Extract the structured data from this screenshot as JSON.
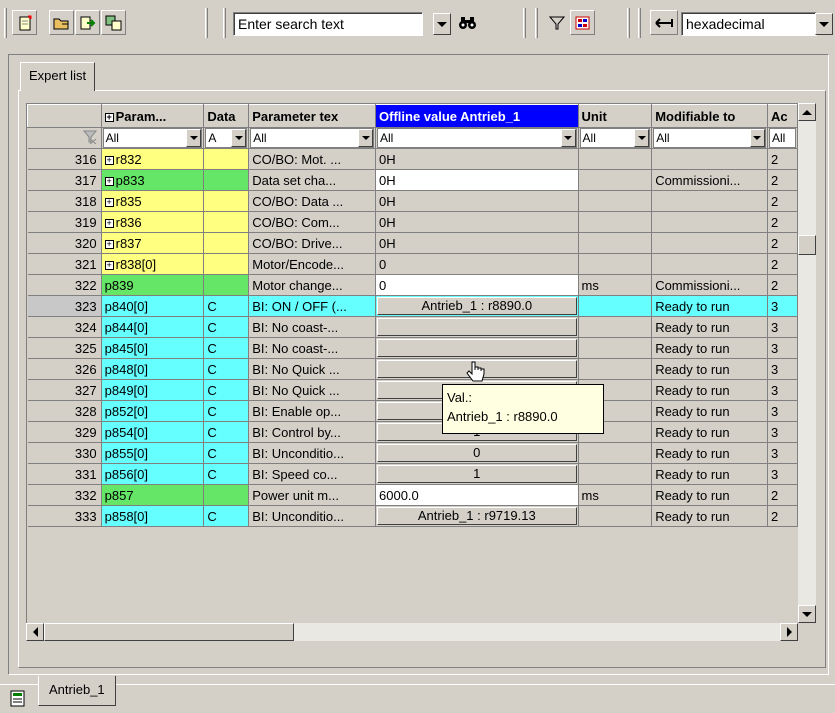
{
  "toolbar": {
    "search_text": "Enter search text",
    "display_mode": "hexadecimal"
  },
  "tabs": {
    "expert_list": "Expert list",
    "drive": "Antrieb_1"
  },
  "columns": [
    {
      "label": "Param...",
      "has_plus": true
    },
    {
      "label": "Data"
    },
    {
      "label": "Parameter tex"
    },
    {
      "label": "Offline value Antrieb_1"
    },
    {
      "label": "Unit"
    },
    {
      "label": "Modifiable to"
    },
    {
      "label": "Ac"
    }
  ],
  "filters": [
    "All",
    "A",
    "All",
    "All",
    "All",
    "All",
    "All"
  ],
  "rows": [
    {
      "num": "316",
      "param": "r832",
      "color": "y",
      "plus": true,
      "data": "",
      "text": "CO/BO: Mot. ...",
      "value": "0H",
      "vstyle": "gr",
      "unit": "",
      "modifiable": "",
      "ac": "2"
    },
    {
      "num": "317",
      "param": "p833",
      "color": "g",
      "plus": true,
      "data": "",
      "text": "Data set cha...",
      "value": "0H",
      "vstyle": "w",
      "unit": "",
      "modifiable": "Commissioni...",
      "ac": "2"
    },
    {
      "num": "318",
      "param": "r835",
      "color": "y",
      "plus": true,
      "data": "",
      "text": "CO/BO: Data ...",
      "value": "0H",
      "vstyle": "gr",
      "unit": "",
      "modifiable": "",
      "ac": "2"
    },
    {
      "num": "319",
      "param": "r836",
      "color": "y",
      "plus": true,
      "data": "",
      "text": "CO/BO: Com...",
      "value": "0H",
      "vstyle": "gr",
      "unit": "",
      "modifiable": "",
      "ac": "2"
    },
    {
      "num": "320",
      "param": "r837",
      "color": "y",
      "plus": true,
      "data": "",
      "text": "CO/BO: Drive...",
      "value": "0H",
      "vstyle": "gr",
      "unit": "",
      "modifiable": "",
      "ac": "2"
    },
    {
      "num": "321",
      "param": "r838[0]",
      "color": "y",
      "plus": true,
      "data": "",
      "text": "Motor/Encode...",
      "value": "0",
      "vstyle": "gr",
      "unit": "",
      "modifiable": "",
      "ac": "2"
    },
    {
      "num": "322",
      "param": "p839",
      "color": "g",
      "plus": false,
      "data": "",
      "text": "Motor change...",
      "value": "0",
      "vstyle": "w",
      "unit": "ms",
      "modifiable": "Commissioni...",
      "ac": "2"
    },
    {
      "num": "323",
      "param": "p840[0]",
      "color": "c",
      "plus": false,
      "data": "C",
      "text": "BI: ON / OFF (...",
      "value": "Antrieb_1 : r8890.0",
      "vstyle": "btn",
      "unit": "",
      "modifiable": "Ready to run",
      "ac": "3",
      "selected": true
    },
    {
      "num": "324",
      "param": "p844[0]",
      "color": "c",
      "plus": false,
      "data": "C",
      "text": "BI: No coast-...",
      "value": "",
      "vstyle": "btn",
      "unit": "",
      "modifiable": "Ready to run",
      "ac": "3"
    },
    {
      "num": "325",
      "param": "p845[0]",
      "color": "c",
      "plus": false,
      "data": "C",
      "text": "BI: No coast-...",
      "value": "",
      "vstyle": "btn",
      "unit": "",
      "modifiable": "Ready to run",
      "ac": "3"
    },
    {
      "num": "326",
      "param": "p848[0]",
      "color": "c",
      "plus": false,
      "data": "C",
      "text": "BI: No Quick ...",
      "value": "",
      "vstyle": "btn",
      "unit": "",
      "modifiable": "Ready to run",
      "ac": "3"
    },
    {
      "num": "327",
      "param": "p849[0]",
      "color": "c",
      "plus": false,
      "data": "C",
      "text": "BI: No Quick ...",
      "value": "1",
      "vstyle": "btn",
      "unit": "",
      "modifiable": "Ready to run",
      "ac": "3"
    },
    {
      "num": "328",
      "param": "p852[0]",
      "color": "c",
      "plus": false,
      "data": "C",
      "text": "BI: Enable op...",
      "value": "1",
      "vstyle": "btn",
      "unit": "",
      "modifiable": "Ready to run",
      "ac": "3"
    },
    {
      "num": "329",
      "param": "p854[0]",
      "color": "c",
      "plus": false,
      "data": "C",
      "text": "BI: Control by...",
      "value": "1",
      "vstyle": "btn",
      "unit": "",
      "modifiable": "Ready to run",
      "ac": "3"
    },
    {
      "num": "330",
      "param": "p855[0]",
      "color": "c",
      "plus": false,
      "data": "C",
      "text": "BI: Unconditio...",
      "value": "0",
      "vstyle": "btn",
      "unit": "",
      "modifiable": "Ready to run",
      "ac": "3"
    },
    {
      "num": "331",
      "param": "p856[0]",
      "color": "c",
      "plus": false,
      "data": "C",
      "text": "BI: Speed co...",
      "value": "1",
      "vstyle": "btn",
      "unit": "",
      "modifiable": "Ready to run",
      "ac": "3"
    },
    {
      "num": "332",
      "param": "p857",
      "color": "g",
      "plus": false,
      "data": "",
      "text": "Power unit m...",
      "value": "6000.0",
      "vstyle": "w",
      "unit": "ms",
      "modifiable": "Ready to run",
      "ac": "2"
    },
    {
      "num": "333",
      "param": "p858[0]",
      "color": "c",
      "plus": false,
      "data": "C",
      "text": "BI: Unconditio...",
      "value": "Antrieb_1 : r9719.13",
      "vstyle": "btn",
      "unit": "",
      "modifiable": "Ready to run",
      "ac": "2"
    }
  ],
  "tooltip": {
    "line1": "Val.:",
    "line2": "Antrieb_1 : r8890.0"
  },
  "colors": {
    "yellow": "#ffff80",
    "green": "#66e666",
    "cyan": "#66ffff",
    "selected_header": "#0000ff"
  }
}
